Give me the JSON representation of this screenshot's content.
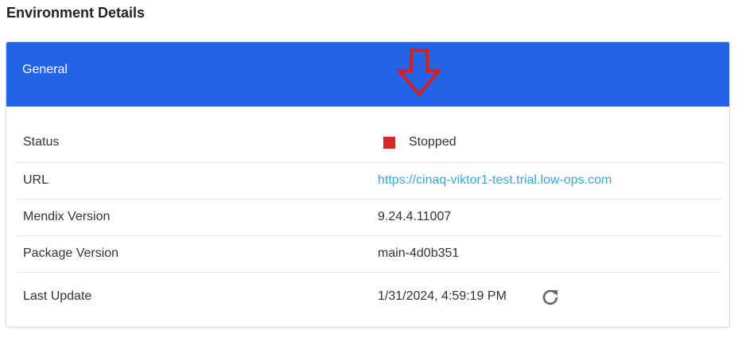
{
  "page": {
    "title": "Environment Details"
  },
  "card": {
    "header_title": "General",
    "header_color": "#2563e6",
    "annotation": {
      "icon": "down-arrow-icon",
      "color": "#d42020"
    }
  },
  "details": {
    "status": {
      "label": "Status",
      "value": "Stopped",
      "indicator_color": "#d62a2a"
    },
    "url": {
      "label": "URL",
      "value": "https://cinaq-viktor1-test.trial.low-ops.com"
    },
    "mendix_version": {
      "label": "Mendix Version",
      "value": "9.24.4.11007"
    },
    "package_version": {
      "label": "Package Version",
      "value": "main-4d0b351"
    },
    "last_update": {
      "label": "Last Update",
      "value": "1/31/2024, 4:59:19 PM",
      "refresh_icon": "refresh-icon"
    }
  }
}
